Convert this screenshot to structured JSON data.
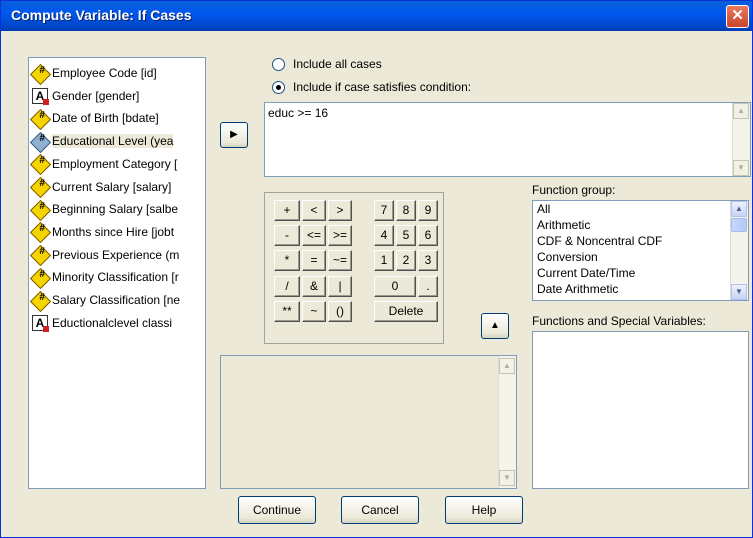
{
  "window": {
    "title": "Compute Variable: If Cases",
    "close_glyph": "✕"
  },
  "variables": [
    {
      "label": "Employee Code [id]",
      "icon": "scale-icon"
    },
    {
      "label": "Gender [gender]",
      "icon": "string-icon"
    },
    {
      "label": "Date of Birth [bdate]",
      "icon": "scale-icon"
    },
    {
      "label": "Educational Level (yea",
      "icon": "scale-icon",
      "selected": true
    },
    {
      "label": "Employment Category [",
      "icon": "scale-icon"
    },
    {
      "label": "Current Salary [salary]",
      "icon": "scale-icon"
    },
    {
      "label": "Beginning Salary [salbe",
      "icon": "scale-icon"
    },
    {
      "label": "Months since Hire [jobt",
      "icon": "scale-icon"
    },
    {
      "label": "Previous Experience (m",
      "icon": "scale-icon"
    },
    {
      "label": "Minority Classification [r",
      "icon": "scale-icon"
    },
    {
      "label": "Salary Classification [ne",
      "icon": "scale-icon"
    },
    {
      "label": "Eductionalclevel classi",
      "icon": "string-icon"
    }
  ],
  "radios": {
    "include_all": "Include all cases",
    "include_if": "Include if case satisfies condition:"
  },
  "expression": "educ >= 16",
  "keypad": {
    "keys": [
      "+",
      "<",
      ">",
      "7",
      "8",
      "9",
      "-",
      "<=",
      ">=",
      "4",
      "5",
      "6",
      "*",
      "=",
      "~=",
      "1",
      "2",
      "3",
      "/",
      "&",
      "|",
      "0",
      ".",
      "**",
      "~",
      "()",
      "Delete"
    ]
  },
  "function_group": {
    "label": "Function group:",
    "items": [
      "All",
      "Arithmetic",
      "CDF & Noncentral CDF",
      "Conversion",
      "Current Date/Time",
      "Date Arithmetic"
    ]
  },
  "functions_special": {
    "label": "Functions and Special Variables:"
  },
  "buttons": {
    "continue": "Continue",
    "cancel": "Cancel",
    "help": "Help"
  },
  "glyphs": {
    "arrow_right": "▶",
    "arrow_up": "▲",
    "scroll_up": "▲",
    "scroll_down": "▼"
  }
}
